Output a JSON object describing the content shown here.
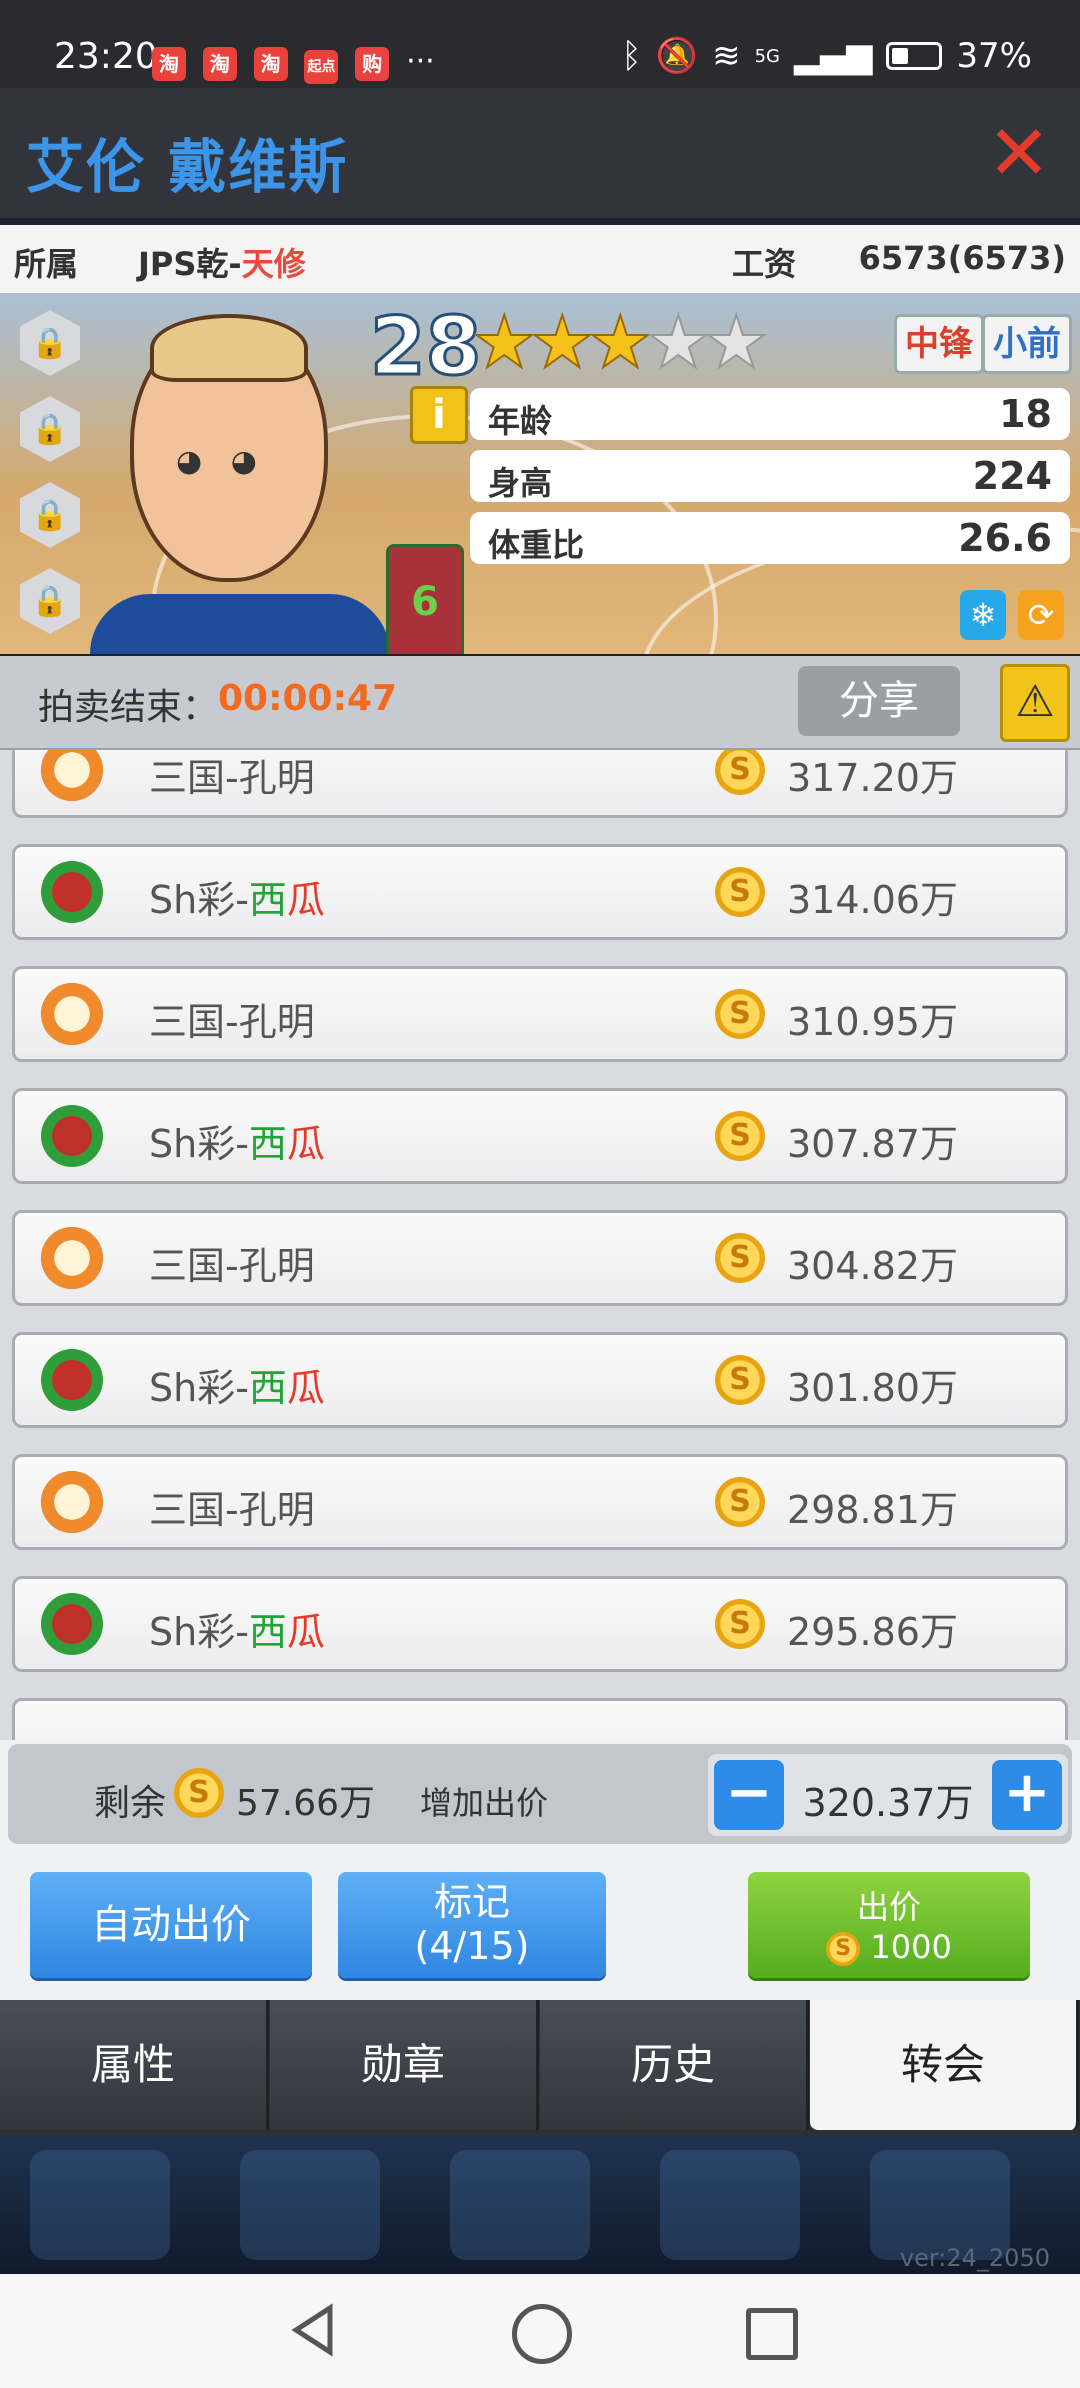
{
  "status_bar": {
    "time": "23:20",
    "app_icons": [
      "淘",
      "淘",
      "淘",
      "起点",
      "购"
    ],
    "more": "···",
    "network": "5G",
    "battery": "37%",
    "battery_level": 0.37
  },
  "header": {
    "player_name": "艾伦 戴维斯",
    "close_icon": "close-icon"
  },
  "info_row": {
    "owner_label": "所属",
    "club_prefix": "JPS乾-",
    "club_suffix": "天修",
    "salary_label": "工资",
    "salary_value": "6573(6573)"
  },
  "player_card": {
    "rating": "28",
    "stars_total": 5,
    "stars_filled": 3,
    "positions": [
      {
        "label": "中锋",
        "color": "#d9412e"
      },
      {
        "label": "小前",
        "color": "#2f6fc4"
      }
    ],
    "info_icon": "i",
    "jersey_number": "6",
    "stats": [
      {
        "label": "年龄",
        "value": "18"
      },
      {
        "label": "身高",
        "value": "224"
      },
      {
        "label": "体重比",
        "value": "26.6"
      }
    ],
    "lock_slots": 4,
    "lock_icon": "lock-icon",
    "snow_icon": "❄",
    "refresh_icon": "⟳"
  },
  "auction": {
    "label": "拍卖结束：",
    "timer": "00:00:47",
    "share_label": "分享",
    "warning_icon": "⚠"
  },
  "bids": [
    {
      "logo": "lion",
      "team_prefix": "三国-孔明",
      "team_green": "",
      "team_red": "",
      "amount": "317.20万"
    },
    {
      "logo": "ball",
      "team_prefix": "Sh彩-",
      "team_green": "西",
      "team_red": "瓜",
      "amount": "314.06万"
    },
    {
      "logo": "lion",
      "team_prefix": "三国-孔明",
      "team_green": "",
      "team_red": "",
      "amount": "310.95万"
    },
    {
      "logo": "ball",
      "team_prefix": "Sh彩-",
      "team_green": "西",
      "team_red": "瓜",
      "amount": "307.87万"
    },
    {
      "logo": "lion",
      "team_prefix": "三国-孔明",
      "team_green": "",
      "team_red": "",
      "amount": "304.82万"
    },
    {
      "logo": "ball",
      "team_prefix": "Sh彩-",
      "team_green": "西",
      "team_red": "瓜",
      "amount": "301.80万"
    },
    {
      "logo": "lion",
      "team_prefix": "三国-孔明",
      "team_green": "",
      "team_red": "",
      "amount": "298.81万"
    },
    {
      "logo": "ball",
      "team_prefix": "Sh彩-",
      "team_green": "西",
      "team_red": "瓜",
      "amount": "295.86万"
    }
  ],
  "controls": {
    "remain_label": "剩余",
    "remain_amount": "57.66万",
    "raise_label": "增加出价",
    "minus": "−",
    "plus": "+",
    "bid_value": "320.37万",
    "auto_bid": "自动出价",
    "mark_line1": "标记",
    "mark_line2": "(4/15)",
    "place_bid": "出价",
    "place_bid_cost": "1000",
    "coin_symbol": "S"
  },
  "tabs": [
    {
      "label": "属性",
      "active": false
    },
    {
      "label": "勋章",
      "active": false
    },
    {
      "label": "历史",
      "active": false
    },
    {
      "label": "转会",
      "active": true
    }
  ],
  "version": "ver:24_2050"
}
